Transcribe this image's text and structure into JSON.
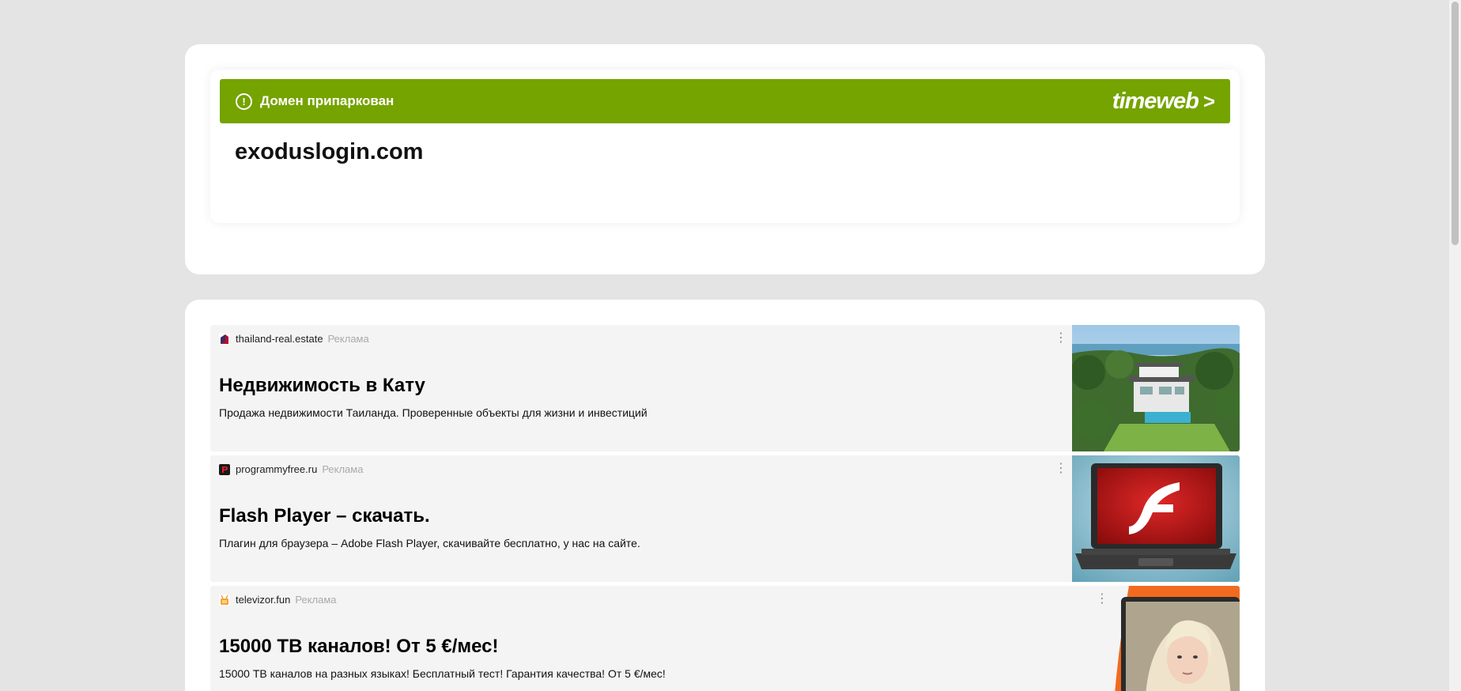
{
  "parked": {
    "status_text": "Домен припаркован",
    "brand": "timeweb",
    "brand_arrow": ">",
    "bar_color": "#75a300"
  },
  "domain": "exoduslogin.com",
  "ads": [
    {
      "domain": "thailand-real.estate",
      "label": "Реклама",
      "title": "Недвижимость в Кату",
      "description": "Продажа недвижимости Таиланда. Проверенные объекты для жизни и инвестиций",
      "menu": "⋮",
      "favicon_icon": "thailand-real-estate-favicon",
      "image_icon": "villa-pool-photo"
    },
    {
      "domain": "programmyfree.ru",
      "label": "Реклама",
      "title": "Flash Player – скачать.",
      "description": "Плагин для браузера – Adobe Flash Player, скачивайте бесплатно, у нас на сайте.",
      "menu": "⋮",
      "favicon_icon": "programmyfree-favicon",
      "image_icon": "laptop-flash-logo"
    },
    {
      "domain": "televizor.fun",
      "label": "Реклама",
      "title": "15000 ТВ каналов! От 5 €/мес!",
      "description": "15000 ТВ каналов на разных языках! Бесплатный тест! Гарантия качества! От 5 €/мес!",
      "menu": "⋮",
      "favicon_icon": "televizor-favicon",
      "image_icon": "tv-portrait-photo"
    }
  ]
}
